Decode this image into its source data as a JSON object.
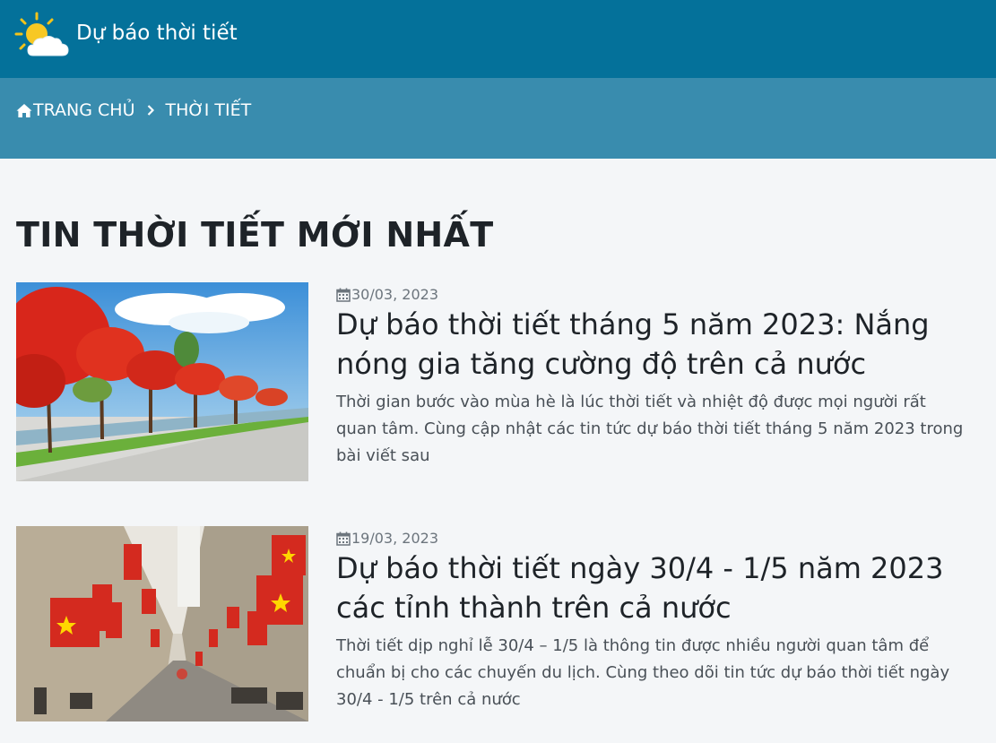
{
  "header": {
    "logo_icon": "sun-cloud-icon",
    "site_title": "Dự báo thời tiết"
  },
  "breadcrumb": {
    "home_label": "TRANG CHỦ",
    "current_label": "THỜI TIẾT",
    "home_icon": "home-icon",
    "separator_icon": "chevron-right-icon"
  },
  "section": {
    "title": "TIN THỜI TIẾT MỚI NHẤT"
  },
  "articles": [
    {
      "date": "30/03, 2023",
      "title": "Dự báo thời tiết tháng 5 năm 2023: Nắng nóng gia tăng cường độ trên cả nước",
      "excerpt": "Thời gian bước vào mùa hè là lúc thời tiết và nhiệt độ được mọi người rất quan tâm. Cùng cập nhật các tin tức dự báo thời tiết tháng 5 năm 2023 trong bài viết sau",
      "image_subject": "red-flame-trees-road"
    },
    {
      "date": "19/03, 2023",
      "title": "Dự báo thời tiết ngày 30/4 - 1/5 năm 2023 các tỉnh thành trên cả nước",
      "excerpt": "Thời tiết dịp nghỉ lễ 30/4 – 1/5 là thông tin được nhiều người quan tâm để chuẩn bị cho các chuyến du lịch. Cùng theo dõi tin tức dự báo thời tiết ngày 30/4 - 1/5 trên cả nước",
      "image_subject": "street-with-flags"
    }
  ],
  "colors": {
    "header_bg": "#04719a",
    "breadcrumb_bg": "#398cae",
    "page_bg": "#f4f6f8",
    "flag_red": "#d42a1f",
    "flag_star": "#ffd600"
  }
}
